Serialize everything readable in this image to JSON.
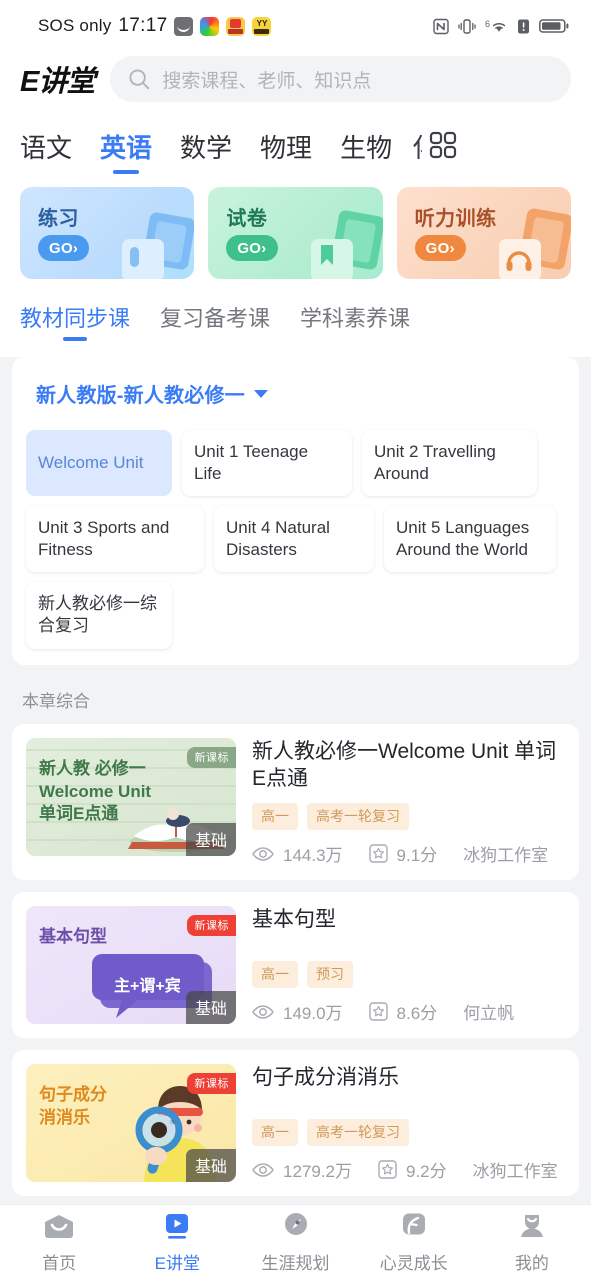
{
  "status_bar": {
    "carrier": "SOS only",
    "time": "17:17",
    "app_icons": [
      "mail-icon",
      "color-app-icon",
      "red-app-icon",
      "yy-app-icon"
    ],
    "right_icons": [
      "nfc-icon",
      "vibrate-icon",
      "wifi-icon",
      "alert-icon",
      "battery-icon"
    ],
    "wifi_superscript": "6"
  },
  "header": {
    "logo": "E讲堂",
    "search_placeholder": "搜索课程、老师、知识点"
  },
  "subjects": {
    "items": [
      {
        "label": "语文",
        "active": false
      },
      {
        "label": "英语",
        "active": true
      },
      {
        "label": "数学",
        "active": false
      },
      {
        "label": "物理",
        "active": false
      },
      {
        "label": "生物",
        "active": false
      }
    ],
    "clipped_label": "化",
    "grid_icon": "grid-icon"
  },
  "promos": [
    {
      "title": "练习",
      "go": "GO›",
      "theme": "blue",
      "art_label": "练习"
    },
    {
      "title": "试卷",
      "go": "GO›",
      "theme": "green",
      "art_label": "试卷"
    },
    {
      "title": "听力训练",
      "go": "GO›",
      "theme": "orange",
      "art_label": "听力"
    }
  ],
  "categories": [
    {
      "label": "教材同步课",
      "active": true
    },
    {
      "label": "复习备考课",
      "active": false
    },
    {
      "label": "学科素养课",
      "active": false
    }
  ],
  "textbook": {
    "selected": "新人教版-新人教必修一",
    "caret_icon": "chevron-down-icon"
  },
  "units": [
    {
      "label": "Welcome Unit",
      "selected": true
    },
    {
      "label": "Unit 1 Teenage Life",
      "selected": false
    },
    {
      "label": "Unit 2 Travelling Around",
      "selected": false
    },
    {
      "label": "Unit 3 Sports and Fitness",
      "selected": false
    },
    {
      "label": "Unit 4 Natural Disasters",
      "selected": false
    },
    {
      "label": "Unit 5 Languages Around the World",
      "selected": false
    },
    {
      "label": "新人教必修一综合复习",
      "selected": false
    }
  ],
  "section": {
    "title": "本章综合"
  },
  "courses": [
    {
      "title": "新人教必修一Welcome Unit 单词E点通",
      "thumb_lines": [
        "新人教 必修一",
        "Welcome Unit",
        "单词E点通"
      ],
      "thumb_theme": "green",
      "badge_new": "新课标",
      "badge_new_color": "#8aa887",
      "badge_level": "基础",
      "tags": [
        "高一",
        "高考一轮复习"
      ],
      "views": "144.3万",
      "rating": "9.1分",
      "author": "冰狗工作室"
    },
    {
      "title": "基本句型",
      "thumb_lines": [
        "基本句型"
      ],
      "thumb_bubble": "主+谓+宾",
      "thumb_theme": "purple",
      "badge_new": "新课标",
      "badge_new_color": "#ef4036",
      "badge_level": "基础",
      "tags": [
        "高一",
        "预习"
      ],
      "views": "149.0万",
      "rating": "8.6分",
      "author": "何立帆"
    },
    {
      "title": "句子成分消消乐",
      "thumb_lines": [
        "句子成分",
        "消消乐"
      ],
      "thumb_theme": "yellow",
      "badge_new": "新课标",
      "badge_new_color": "#ef4036",
      "badge_level": "基础",
      "tags": [
        "高一",
        "高考一轮复习"
      ],
      "views": "1279.2万",
      "rating": "9.2分",
      "author": "冰狗工作室"
    }
  ],
  "tabbar": [
    {
      "label": "首页",
      "icon": "home-icon",
      "active": false
    },
    {
      "label": "E讲堂",
      "icon": "video-icon",
      "active": true
    },
    {
      "label": "生涯规划",
      "icon": "compass-icon",
      "active": false
    },
    {
      "label": "心灵成长",
      "icon": "leaf-icon",
      "active": false
    },
    {
      "label": "我的",
      "icon": "person-icon",
      "active": false
    }
  ],
  "colors": {
    "accent": "#3b7cf6",
    "page_bg": "#f2f3f5",
    "tag_bg": "#fdeddc",
    "tag_text": "#d09a5d"
  }
}
